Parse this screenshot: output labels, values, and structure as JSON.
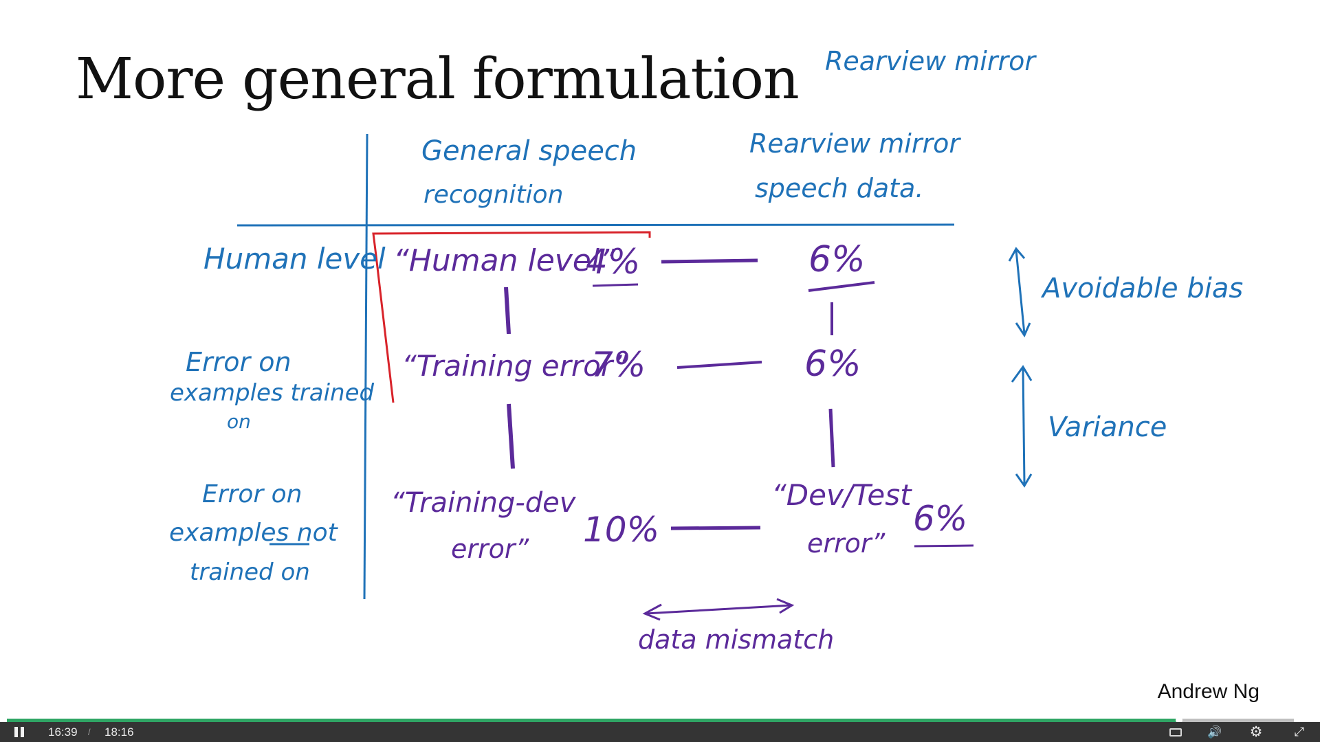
{
  "slide": {
    "title": "More general formulation",
    "author": "Andrew Ng",
    "annotation_top": "Rearview mirror",
    "columns": {
      "general": [
        "General speech",
        "recognition"
      ],
      "rearview": [
        "Rearview mirror",
        "speech data."
      ]
    },
    "rows": {
      "human": "Human level",
      "trained": [
        "Error on",
        "examples trained",
        "on"
      ],
      "not_trained": [
        "Error on",
        "examples not",
        "trained on"
      ]
    },
    "cells": {
      "human_level_label": "“Human level”",
      "human_level_general": "4%",
      "human_level_rearview": "6%",
      "training_error_label": "“Training error”",
      "training_error_general": "7%",
      "training_error_rearview": "6%",
      "training_dev_label": [
        "“Training-dev",
        "error”"
      ],
      "training_dev_general": "10%",
      "dev_test_label": [
        "“Dev/Test",
        "error”"
      ],
      "dev_test_rearview": "6%"
    },
    "side_labels": {
      "avoidable_bias": "Avoidable bias",
      "variance": "Variance",
      "data_mismatch": "data mismatch"
    },
    "colors": {
      "blue_ink": "#1f72b8",
      "purple_ink": "#5b2a9a",
      "red_ink": "#d8232a"
    }
  },
  "player": {
    "state": "playing",
    "current_time": "16:39",
    "separator": "/",
    "total_time": "18:16",
    "progress_fraction": 0.911,
    "icons": {
      "pause": "pause-icon",
      "captions": "captions-icon",
      "volume": "volume-icon",
      "settings": "gear-icon",
      "fullscreen": "exit-fullscreen-icon"
    }
  }
}
